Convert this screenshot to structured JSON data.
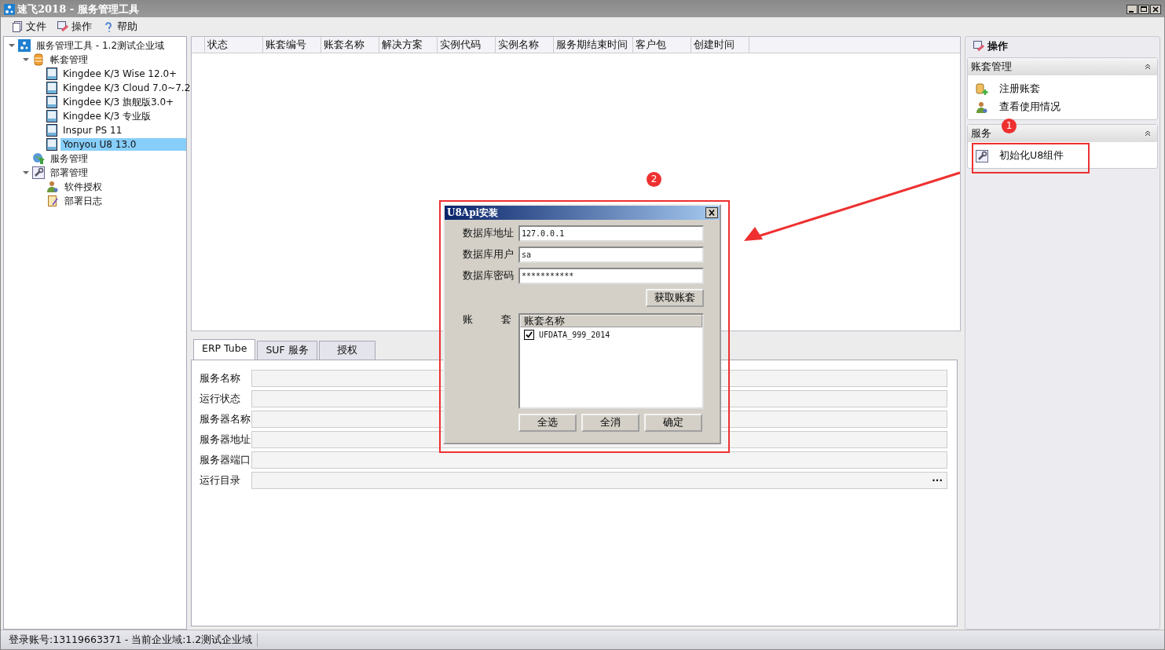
{
  "window": {
    "title": "速飞2018 - 服务管理工具"
  },
  "menu": [
    {
      "label": "文件",
      "kind": "file"
    },
    {
      "label": "操作",
      "kind": "ops"
    },
    {
      "label": "帮助",
      "kind": "help"
    }
  ],
  "tree": [
    {
      "label": "服务管理工具 - 1.2测试企业域",
      "kind": "domain",
      "expanded": true,
      "selected": false,
      "children": [
        {
          "label": "帐套管理",
          "kind": "database",
          "expanded": true,
          "selected": false,
          "children": [
            {
              "label": "Kingdee K/3 Wise 12.0+",
              "kind": "book",
              "selected": false
            },
            {
              "label": "Kingdee K/3 Cloud 7.0~7.2",
              "kind": "book",
              "selected": false
            },
            {
              "label": "Kingdee K/3 旗舰版3.0+",
              "kind": "book",
              "selected": false
            },
            {
              "label": "Kingdee K/3 专业版",
              "kind": "book",
              "selected": false
            },
            {
              "label": "Inspur PS 11",
              "kind": "book",
              "selected": false
            },
            {
              "label": "Yonyou U8 13.0",
              "kind": "book",
              "selected": true
            }
          ]
        },
        {
          "label": "服务管理",
          "kind": "globe",
          "selected": false
        },
        {
          "label": "部署管理",
          "kind": "tool",
          "expanded": true,
          "selected": false,
          "children": [
            {
              "label": "软件授权",
              "kind": "user",
              "selected": false
            },
            {
              "label": "部署日志",
              "kind": "log",
              "selected": false
            }
          ]
        }
      ]
    }
  ],
  "table": {
    "columns": [
      "状态",
      "账套编号",
      "账套名称",
      "解决方案",
      "实例代码",
      "实例名称",
      "服务期结束时间",
      "客户包",
      "创建时间"
    ]
  },
  "tabs": [
    {
      "label": "ERP Tube",
      "selected": true
    },
    {
      "label": "SUF 服务",
      "selected": false
    },
    {
      "label": "授权",
      "selected": false
    }
  ],
  "form": [
    {
      "label": "服务名称"
    },
    {
      "label": "运行状态"
    },
    {
      "label": "服务器名称"
    },
    {
      "label": "服务器地址"
    },
    {
      "label": "服务器端口"
    },
    {
      "label": "运行目录",
      "button": "···"
    }
  ],
  "actions": {
    "title": "操作",
    "groups": [
      {
        "title": "账套管理",
        "expanded": true,
        "items": [
          {
            "label": "注册账套",
            "kind": "register"
          },
          {
            "label": "查看使用情况",
            "kind": "usage"
          }
        ]
      },
      {
        "title": "服务",
        "expanded": true,
        "items": [
          {
            "label": "初始化U8组件",
            "kind": "tool"
          }
        ]
      }
    ]
  },
  "dialog": {
    "title": "U8Api安装",
    "fields": [
      {
        "label": "数据库地址",
        "value": "127.0.0.1"
      },
      {
        "label": "数据库用户",
        "value": "sa"
      },
      {
        "label": "数据库密码",
        "value": "***********"
      }
    ],
    "fetch_button": "获取账套",
    "list_label": "账套",
    "list_column": "账套名称",
    "rows": [
      {
        "name": "UFDATA_999_2014",
        "checked": true
      }
    ],
    "buttons": [
      "全选",
      "全消",
      "确定"
    ]
  },
  "annotations": [
    "1",
    "2"
  ],
  "status_bar": "登录账号:13119663371 - 当前企业域:1.2测试企业域"
}
